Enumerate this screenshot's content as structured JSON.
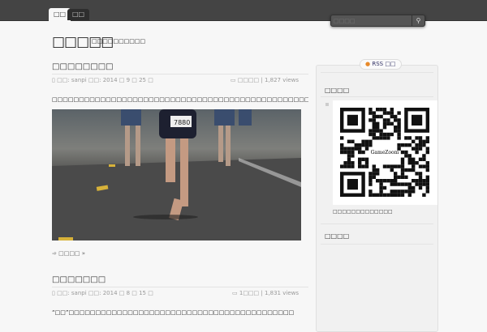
{
  "nav": {
    "tabs": [
      {
        "label": "□□"
      },
      {
        "label": "□□"
      }
    ]
  },
  "search": {
    "placeholder": "□□□□",
    "icon": "search-icon"
  },
  "site": {
    "title": "□□□□□",
    "tagline": "□□□□□□□□□□"
  },
  "posts": [
    {
      "title": "□□□□□□□□",
      "meta_left": "□□: sanpi □□: 2014 □ 9 □ 25 □",
      "meta_right": "□□□□ | 1,827 views",
      "excerpt": "□□□□□□□□□□□□□□□□□□□□□□□□□□□□□□□□□□□□□□□□□□□□□□□□□□□",
      "more": "□□□□ »",
      "photo_bib": "7880"
    },
    {
      "title": "□□□□□□□",
      "meta_left": "□□: sanpi □□: 2014 □ 8 □ 15 □",
      "meta_right": "1□□□ | 1,831 views",
      "excerpt": "“□□”□□□□□□□□□□□□□□□□□□□□□□□□□□□□□□□□□□□□□□□□□□"
    }
  ],
  "sidebar": {
    "rss_label": "RSS □□",
    "widget1_title": "□□□□",
    "qr_center": "GameZoom",
    "qr_caption": "□□□□□□□□□□□□□",
    "widget2_title": "□□□□"
  }
}
